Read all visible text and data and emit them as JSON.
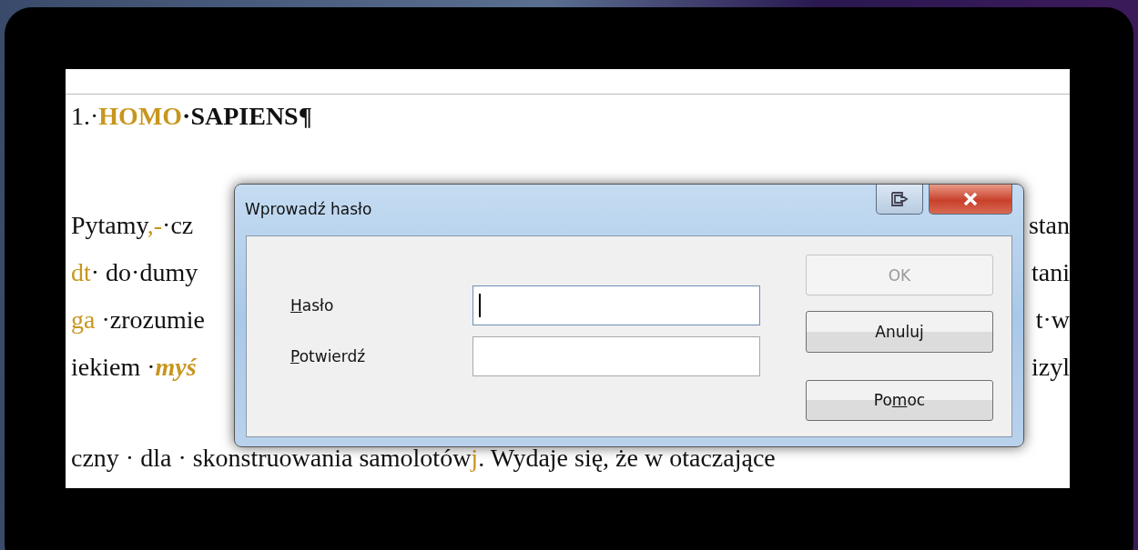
{
  "document": {
    "heading": [
      {
        "text": "1.·",
        "kind": "plain"
      },
      {
        "text": "HOMO",
        "kind": "mark"
      },
      {
        "text": "·SAPIENS¶",
        "kind": "plain"
      }
    ],
    "lines": [
      {
        "left": [
          {
            "text": "Pytamy",
            "kind": "plain"
          },
          {
            "text": ",-",
            "kind": "mark"
          },
          {
            "text": "·cz",
            "kind": "plain"
          }
        ],
        "right": [
          {
            "text": "stan",
            "kind": "plain"
          }
        ]
      },
      {
        "left": [
          {
            "text": "dt",
            "kind": "mark"
          },
          {
            "text": "· do·dumy",
            "kind": "plain"
          }
        ],
        "right": [
          {
            "text": "tani",
            "kind": "plain"
          }
        ]
      },
      {
        "left": [
          {
            "text": "ga ",
            "kind": "mark"
          },
          {
            "text": "·zrozumie",
            "kind": "plain"
          }
        ],
        "right": [
          {
            "text": "t·w",
            "kind": "plain"
          }
        ]
      },
      {
        "left": [
          {
            "text": "iekiem ·",
            "kind": "plain"
          },
          {
            "text": "myś",
            "kind": "italic_mark"
          }
        ],
        "right": [
          {
            "text": "izyl",
            "kind": "plain"
          }
        ]
      },
      {
        "left": [
          {
            "text": "czny · dla · skonstruowania samolotów",
            "kind": "plain"
          },
          {
            "text": "j",
            "kind": "mark"
          },
          {
            "text": ". Wydaje się, że w otaczające",
            "kind": "plain"
          }
        ]
      }
    ]
  },
  "dialog": {
    "title": "Wprowadź hasło",
    "fields": [
      {
        "mnemonic": "H",
        "after": "asło",
        "focused": true
      },
      {
        "mnemonic": "P",
        "after": "otwierdź",
        "focused": false
      }
    ],
    "buttons": [
      {
        "before": "OK",
        "disabled": true
      },
      {
        "before": "Anuluj",
        "disabled": false
      },
      {
        "before": "Po",
        "mnemonic": "m",
        "after": "oc",
        "disabled": false
      }
    ]
  }
}
